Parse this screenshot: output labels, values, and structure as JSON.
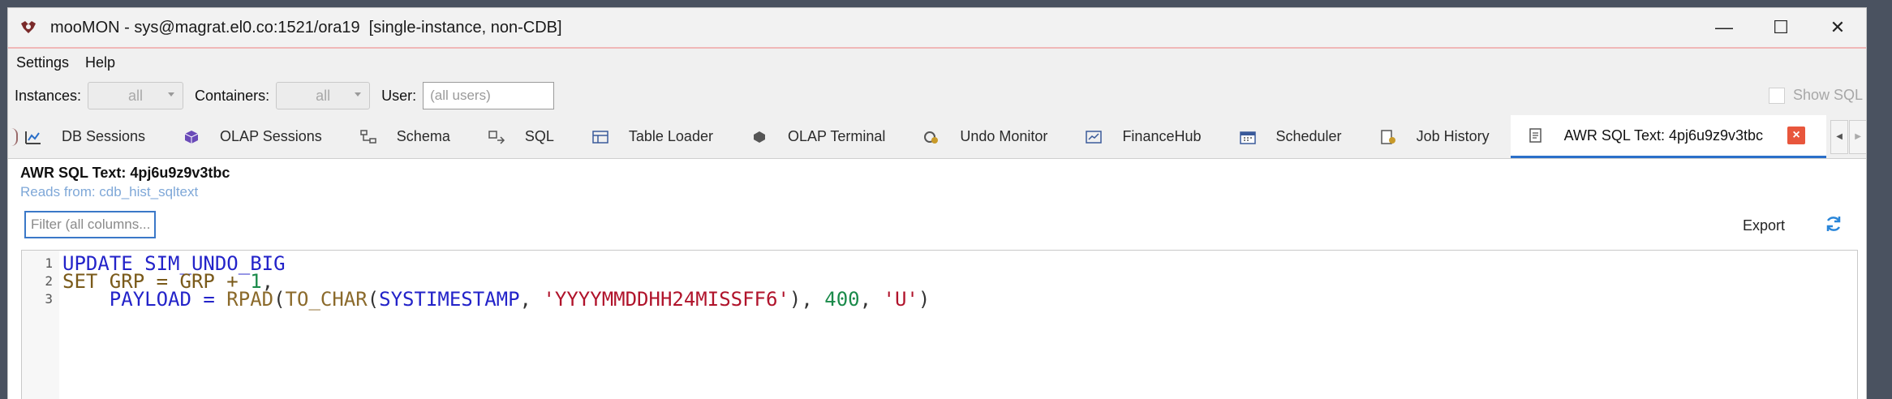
{
  "window": {
    "title": "mooMON - sys@magrat.el0.co:1521/ora19  [single-instance, non-CDB]",
    "controls": {
      "minimize": "—",
      "maximize": "☐",
      "close": "✕"
    }
  },
  "menu": {
    "settings": "Settings",
    "help": "Help"
  },
  "toolbar": {
    "instances_label": "Instances:",
    "instances_value": "all",
    "containers_label": "Containers:",
    "containers_value": "all",
    "user_label": "User:",
    "user_placeholder": "(all users)",
    "show_sql_label": "Show SQL"
  },
  "tabs": [
    {
      "label": "DB Sessions",
      "icon": "sessions-chart-icon"
    },
    {
      "label": "OLAP Sessions",
      "icon": "olap-cube-icon"
    },
    {
      "label": "Schema",
      "icon": "schema-tree-icon"
    },
    {
      "label": "SQL",
      "icon": "sql-icon"
    },
    {
      "label": "Table Loader",
      "icon": "table-loader-icon"
    },
    {
      "label": "OLAP Terminal",
      "icon": "terminal-cube-icon"
    },
    {
      "label": "Undo Monitor",
      "icon": "undo-monitor-icon"
    },
    {
      "label": "FinanceHub",
      "icon": "finance-icon"
    },
    {
      "label": "Scheduler",
      "icon": "calendar-icon"
    },
    {
      "label": "Job History",
      "icon": "job-history-icon"
    },
    {
      "label": "AWR SQL Text: 4pj6u9z9v3tbc",
      "icon": "document-icon",
      "active": true
    }
  ],
  "panel": {
    "title": "AWR SQL Text: 4pj6u9z9v3tbc",
    "subtitle": "Reads from: cdb_hist_sqltext",
    "filter_placeholder": "Filter (all columns...",
    "export_label": "Export"
  },
  "editor": {
    "line_numbers": [
      "1",
      "2",
      "3"
    ],
    "lines": [
      "UPDATE SIM_UNDO_BIG",
      "SET GRP = GRP + 1,",
      "    PAYLOAD = RPAD(TO_CHAR(SYSTIMESTAMP, 'YYYYMMDDHH24MISSFF6'), 400, 'U')"
    ],
    "tokens": {
      "l1_kw": "UPDATE SIM_UNDO_BIG",
      "l2_set": "SET GRP = GRP + ",
      "l2_num": "1",
      "l2_comma": ",",
      "l3_indent": "    ",
      "l3_kw": "PAYLOAD = ",
      "l3_fn1": "RPAD",
      "l3_p1": "(",
      "l3_fn2": "TO_CHAR",
      "l3_p2": "(",
      "l3_id": "SYSTIMESTAMP",
      "l3_c1": ", ",
      "l3_str1": "'YYYYMMDDHH24MISSFF6'",
      "l3_p3": "), ",
      "l3_num": "400",
      "l3_c2": ", ",
      "l3_str2": "'U'",
      "l3_p4": ")"
    }
  },
  "colors": {
    "keyword": "#2323c9",
    "function": "#8b6a2b",
    "string": "#b0132b",
    "number": "#1a8a4a",
    "active_tab_underline": "#2a6fc9",
    "close_tab": "#e8563c",
    "subtitle": "#7fa8d8"
  }
}
